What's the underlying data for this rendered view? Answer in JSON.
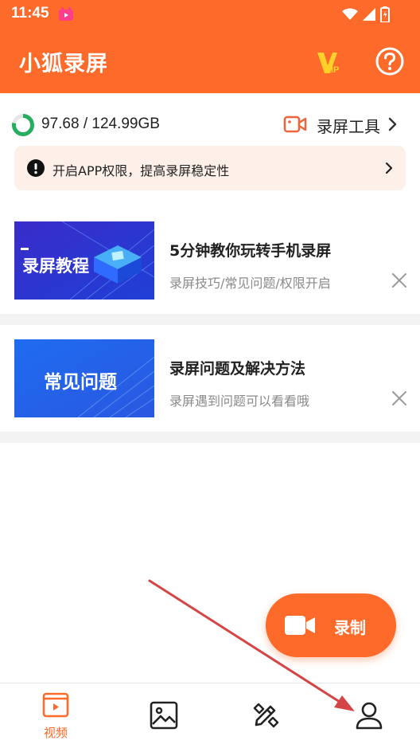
{
  "status_bar": {
    "time": "11:45"
  },
  "header": {
    "title": "小狐录屏",
    "vip_icon": "vip-icon",
    "help_icon": "help-icon"
  },
  "storage": {
    "text": "97.68 / 124.99GB",
    "used_fraction": 0.78
  },
  "tools": {
    "label": "录屏工具"
  },
  "permission_banner": {
    "text": "开启APP权限，提高录屏稳定性"
  },
  "cards": [
    {
      "image_text": "录屏教程",
      "title": "5分钟教你玩转手机录屏",
      "subtitle": "录屏技巧/常见问题/权限开启"
    },
    {
      "image_text": "常见问题",
      "title": "录屏问题及解决方法",
      "subtitle": "录屏遇到问题可以看看哦"
    }
  ],
  "fab": {
    "label": "录制"
  },
  "bottom_nav": {
    "items": [
      {
        "label": "视频",
        "icon": "video-icon",
        "active": true
      },
      {
        "label": "",
        "icon": "gallery-icon",
        "active": false
      },
      {
        "label": "",
        "icon": "edit-tools-icon",
        "active": false
      },
      {
        "label": "",
        "icon": "profile-icon",
        "active": false
      }
    ]
  },
  "colors": {
    "brand": "#fd6a2a",
    "banner_bg": "#fdf0e8",
    "storage_ring": "#27ae60",
    "annotation_arrow": "#d64545"
  }
}
